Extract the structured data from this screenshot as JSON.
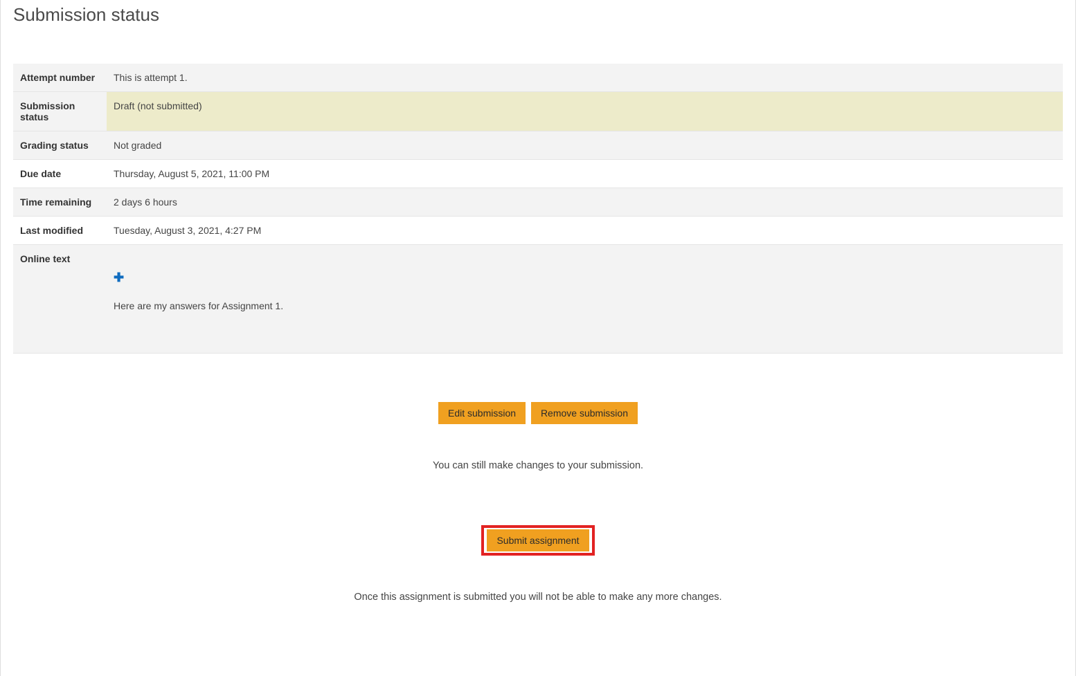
{
  "page": {
    "title": "Submission status"
  },
  "status": {
    "attempt_label": "Attempt number",
    "attempt_value": "This is attempt 1.",
    "submission_label": "Submission status",
    "submission_value": "Draft (not submitted)",
    "grading_label": "Grading status",
    "grading_value": "Not graded",
    "due_label": "Due date",
    "due_value": "Thursday, August 5, 2021, 11:00 PM",
    "remaining_label": "Time remaining",
    "remaining_value": "2 days 6 hours",
    "modified_label": "Last modified",
    "modified_value": "Tuesday, August 3, 2021, 4:27 PM",
    "onlinetext_label": "Online text",
    "onlinetext_value": "Here are my answers for Assignment 1."
  },
  "buttons": {
    "edit": "Edit submission",
    "remove": "Remove submission",
    "submit": "Submit assignment"
  },
  "hints": {
    "can_edit": "You can still make changes to your submission.",
    "final": "Once this assignment is submitted you will not be able to make any more changes."
  }
}
